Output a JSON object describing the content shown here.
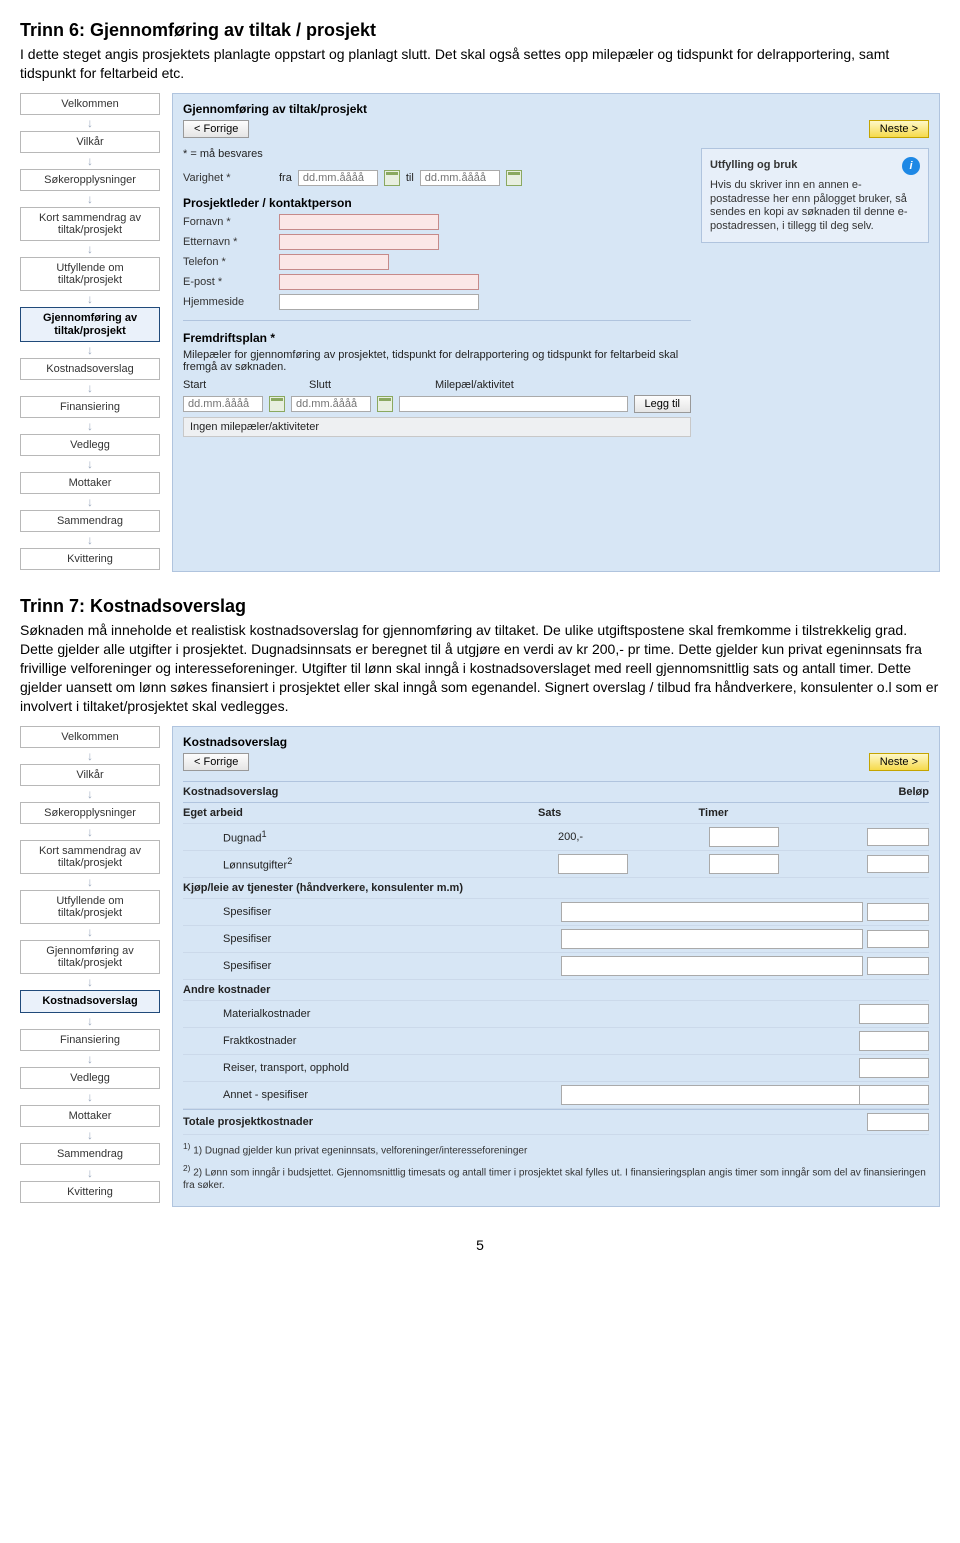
{
  "sections": {
    "s6_title": "Trinn 6: Gjennomføring av tiltak / prosjekt",
    "s6_body": "I dette steget angis prosjektets planlagte oppstart og planlagt slutt. Det skal også settes opp milepæler og tidspunkt for delrapportering, samt tidspunkt for feltarbeid etc.",
    "s7_title": "Trinn 7: Kostnadsoverslag",
    "s7_body": "Søknaden må inneholde et realistisk kostnadsoverslag for gjennomføring av tiltaket. De ulike utgiftspostene skal fremkomme i tilstrekkelig grad. Dette gjelder alle utgifter i prosjektet. Dugnadsinnsats er beregnet til å utgjøre en verdi av kr 200,- pr time. Dette gjelder kun privat egeninnsats fra frivillige velforeninger og interesseforeninger. Utgifter til lønn skal inngå i kostnadsoverslaget med reell gjennomsnittlig sats og antall timer. Dette gjelder uansett om lønn søkes finansiert i prosjektet eller skal inngå som egenandel. Signert overslag / tilbud fra håndverkere, konsulenter o.l som er involvert i tiltaket/prosjektet skal vedlegges."
  },
  "sidebar": {
    "steps": [
      "Velkommen",
      "Vilkår",
      "Søkeropplysninger",
      "Kort sammendrag av tiltak/prosjekt",
      "Utfyllende om tiltak/prosjekt",
      "Gjennomføring av tiltak/prosjekt",
      "Kostnadsoverslag",
      "Finansiering",
      "Vedlegg",
      "Mottaker",
      "Sammendrag",
      "Kvittering"
    ]
  },
  "nav": {
    "prev": "< Forrige",
    "next": "Neste >",
    "add": "Legg til"
  },
  "shot1": {
    "title": "Gjennomføring av tiltak/prosjekt",
    "must": "* = må besvares",
    "varighet": "Varighet *",
    "fra": "fra",
    "til": "til",
    "date_ph": "dd.mm.åååå",
    "pl_title": "Prosjektleder / kontaktperson",
    "fornavn": "Fornavn *",
    "etternavn": "Etternavn *",
    "telefon": "Telefon *",
    "epost": "E-post *",
    "hjemmeside": "Hjemmeside",
    "fp_title": "Fremdriftsplan *",
    "fp_desc": "Milepæler for gjennomføring av prosjektet, tidspunkt for delrapportering og tidspunkt for feltarbeid skal fremgå av søknaden.",
    "start": "Start",
    "slutt": "Slutt",
    "milepael": "Milepæl/aktivitet",
    "ingen": "Ingen milepæler/aktiviteter",
    "info_title": "Utfylling og bruk",
    "info_body": "Hvis du skriver inn en annen e-postadresse her enn pålogget bruker, så sendes en kopi av søknaden til denne e-postadressen, i tillegg til deg selv."
  },
  "shot2": {
    "title": "Kostnadsoverslag",
    "kov": "Kostnadsoverslag",
    "belop": "Beløp",
    "eget": "Eget arbeid",
    "sats": "Sats",
    "timer": "Timer",
    "dugnad": "Dugnad",
    "dugnad_sats": "200,-",
    "lonn": "Lønnsutgifter",
    "kjop": "Kjøp/leie av tjenester (håndverkere, konsulenter m.m)",
    "spes": "Spesifiser",
    "andre": "Andre kostnader",
    "material": "Materialkostnader",
    "frakt": "Fraktkostnader",
    "reiser": "Reiser, transport, opphold",
    "annet": "Annet - spesifiser",
    "total": "Totale prosjektkostnader",
    "fn1": "1) Dugnad gjelder kun privat egeninnsats, velforeninger/interesseforeninger",
    "fn2": "2) Lønn som inngår i budsjettet. Gjennomsnittlig timesats og antall timer i prosjektet skal fylles ut. I finansieringsplan angis timer som inngår som del av finansieringen fra søker."
  },
  "page": "5"
}
